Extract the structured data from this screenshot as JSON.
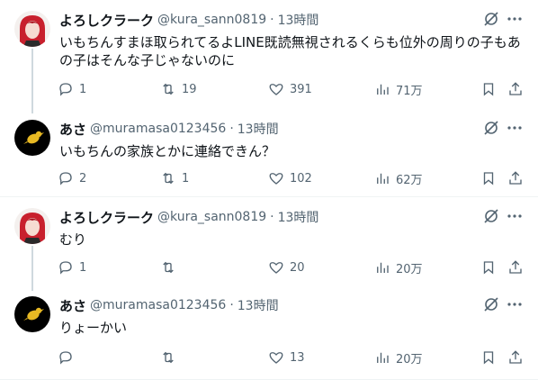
{
  "tweets": [
    {
      "name": "よろしクラーク",
      "handle": "@kura_sann0819",
      "time": "13時間",
      "text_lines": [
        "いもちんすまほ取られてるよLINE既読無視されるくらも位外の周りの子もあ",
        "の子はそんな子じゃないのに"
      ],
      "replies": "1",
      "retweets": "19",
      "likes": "391",
      "views": "71万",
      "avatar": "red-hair-anime-avatar"
    },
    {
      "name": "あさ",
      "handle": "@muramasa0123456",
      "time": "13時間",
      "text_lines": [
        "いもちんの家族とかに連絡できん？"
      ],
      "replies": "2",
      "retweets": "1",
      "likes": "102",
      "views": "62万",
      "avatar": "black-avatar-yellow-bird"
    },
    {
      "name": "よろしクラーク",
      "handle": "@kura_sann0819",
      "time": "13時間",
      "text_lines": [
        "むり"
      ],
      "replies": "1",
      "retweets": "",
      "likes": "20",
      "views": "20万",
      "avatar": "red-hair-anime-avatar"
    },
    {
      "name": "あさ",
      "handle": "@muramasa0123456",
      "time": "13時間",
      "text_lines": [
        "りょーかい"
      ],
      "replies": "",
      "retweets": "",
      "likes": "13",
      "views": "20万",
      "avatar": "black-avatar-yellow-bird"
    }
  ],
  "separator": "·",
  "colors": {
    "text": "#0f1419",
    "secondary": "#536471",
    "thread_line": "#cfd9de",
    "divider": "#eff3f4",
    "avatar_red": "#c8202d",
    "avatar_black": "#000000",
    "bird_yellow": "#e8b923"
  }
}
